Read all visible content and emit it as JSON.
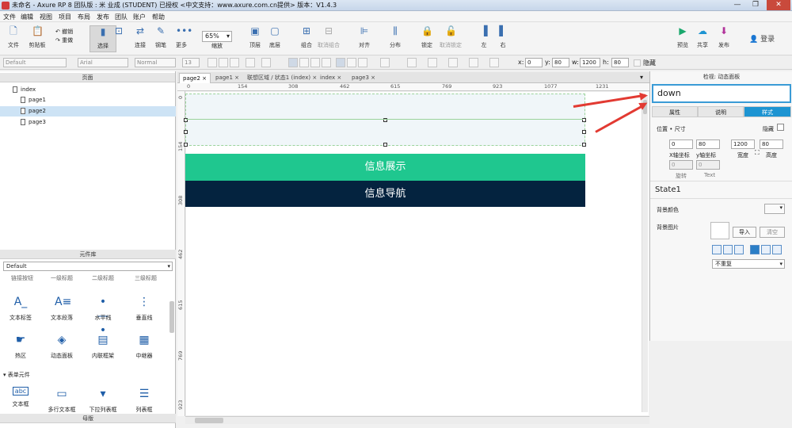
{
  "window": {
    "title": "未命名 - Axure RP 8 团队版 : 米 业成 (STUDENT) 已授权       <中文支持：www.axure.com.cn提供> 版本：V1.4.3",
    "minimize": "—",
    "maximize": "❐",
    "close": "✕"
  },
  "menu": [
    "文件",
    "编辑",
    "视图",
    "项目",
    "布局",
    "发布",
    "团队",
    "账户",
    "帮助"
  ],
  "toolbar": {
    "file": "文件",
    "clipboard": "剪贴板",
    "undo": "撤销",
    "redo": "重做",
    "select": "选择",
    "connect": "连接",
    "pen": "钢笔",
    "more": "更多",
    "zoom_value": "65%",
    "zoom_label": "缩放",
    "top": "顶层",
    "bottom": "底层",
    "group": "组合",
    "ungroup": "取消组合",
    "align": "对齐",
    "distribute": "分布",
    "lock": "锁定",
    "unlock": "取消锁定",
    "left": "左",
    "right": "右",
    "preview": "预览",
    "share": "共享",
    "publish": "发布",
    "login": "登录"
  },
  "format": {
    "style": "Default",
    "font": "Arial",
    "weight": "Normal",
    "size": "13",
    "x_label": "x:",
    "x": "0",
    "y_label": "y:",
    "y": "80",
    "w_label": "w:",
    "w": "1200",
    "h_label": "h:",
    "h": "80",
    "hidden": "隐藏"
  },
  "pages_panel": {
    "title": "页面",
    "pages": [
      "index",
      "page1",
      "page2",
      "page3"
    ]
  },
  "library_panel": {
    "title": "元件库",
    "library": "Default",
    "row0": [
      "链接按钮",
      "一级标题",
      "二级标题",
      "三级标题"
    ],
    "items": [
      {
        "icon": "A_",
        "label": "文本标签"
      },
      {
        "icon": "A≡",
        "label": "文本段落"
      },
      {
        "icon": "•—•",
        "label": "水平线"
      },
      {
        "icon": "⋮",
        "label": "垂直线"
      },
      {
        "icon": "☛",
        "label": "热区"
      },
      {
        "icon": "◈",
        "label": "动态面板"
      },
      {
        "icon": "▤",
        "label": "内联框架"
      },
      {
        "icon": "▦",
        "label": "中继器"
      }
    ],
    "form_section": "表单元件",
    "form_items": [
      {
        "icon": "abc",
        "label": "文本框"
      },
      {
        "icon": "▭",
        "label": "多行文本框"
      },
      {
        "icon": "▾",
        "label": "下拉列表框"
      },
      {
        "icon": "☰",
        "label": "列表框"
      }
    ],
    "masters_title": "母版"
  },
  "tabs": [
    "page2",
    "page1",
    "联想区域 / 状态1 (index)",
    "index",
    "page3"
  ],
  "ruler_h": [
    "0",
    "154",
    "308",
    "462",
    "615",
    "769",
    "923",
    "1077",
    "1231"
  ],
  "ruler_v": [
    "0",
    "154",
    "308",
    "462",
    "615",
    "769",
    "923"
  ],
  "canvas": {
    "banner_green": "信息展示",
    "banner_dark": "信息导航"
  },
  "inspector": {
    "title": "检视: 动态面板",
    "name_value": "down",
    "tabs": [
      "属性",
      "说明",
      "样式"
    ],
    "position_label": "位置 • 尺寸",
    "hidden_label": "隐藏",
    "x": "0",
    "y": "80",
    "w": "1200",
    "h": "80",
    "x_label": "X轴坐标",
    "y_label": "y轴坐标",
    "w_label": "宽度",
    "h_label": "高度",
    "rot": "0",
    "rot2": "0",
    "rot_label": "旋转",
    "text_label": "Text",
    "state": "State1",
    "bg_color_label": "背景颜色",
    "bg_image_label": "背景图片",
    "import": "导入",
    "clear": "清空",
    "repeat": "不重复"
  },
  "colors": {
    "green": "#1fc78f",
    "dark": "#04233f",
    "accent": "#1d94d2",
    "arrow": "#e23a32"
  }
}
